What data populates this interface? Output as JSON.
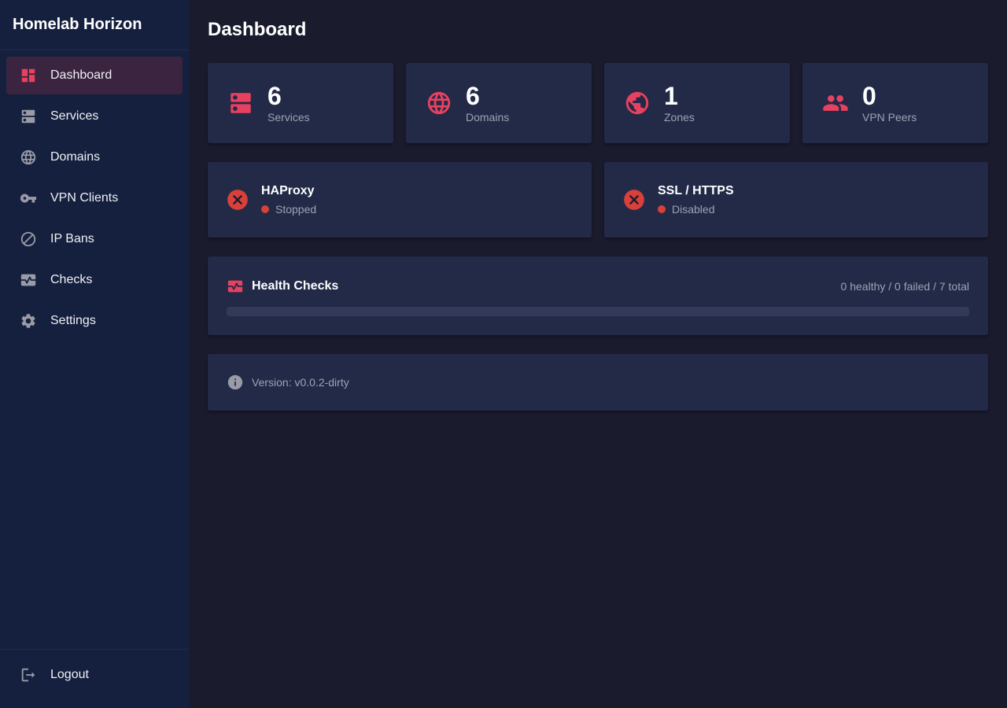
{
  "app": {
    "title": "Homelab Horizon"
  },
  "sidebar": {
    "items": [
      {
        "label": "Dashboard",
        "icon": "dashboard-icon",
        "active": true
      },
      {
        "label": "Services",
        "icon": "server-icon",
        "active": false
      },
      {
        "label": "Domains",
        "icon": "globe-icon",
        "active": false
      },
      {
        "label": "VPN Clients",
        "icon": "key-icon",
        "active": false
      },
      {
        "label": "IP Bans",
        "icon": "block-icon",
        "active": false
      },
      {
        "label": "Checks",
        "icon": "monitor-heart-icon",
        "active": false
      },
      {
        "label": "Settings",
        "icon": "gear-icon",
        "active": false
      }
    ],
    "logout_label": "Logout"
  },
  "page": {
    "title": "Dashboard"
  },
  "stats": [
    {
      "value": "6",
      "label": "Services",
      "icon": "server-icon"
    },
    {
      "value": "6",
      "label": "Domains",
      "icon": "globe-icon"
    },
    {
      "value": "1",
      "label": "Zones",
      "icon": "public-globe-icon"
    },
    {
      "value": "0",
      "label": "VPN Peers",
      "icon": "people-icon"
    }
  ],
  "status": [
    {
      "name": "HAProxy",
      "state": "Stopped"
    },
    {
      "name": "SSL / HTTPS",
      "state": "Disabled"
    }
  ],
  "health": {
    "title": "Health Checks",
    "summary": "0 healthy / 0 failed / 7 total",
    "progress_fraction": 0
  },
  "version": {
    "text": "Version: v0.0.2-dirty"
  },
  "colors": {
    "accent": "#e8415f",
    "error": "#d9403a",
    "sidebar_bg": "#15203f",
    "main_bg": "#1a1b2d",
    "card_bg": "#222a47"
  }
}
